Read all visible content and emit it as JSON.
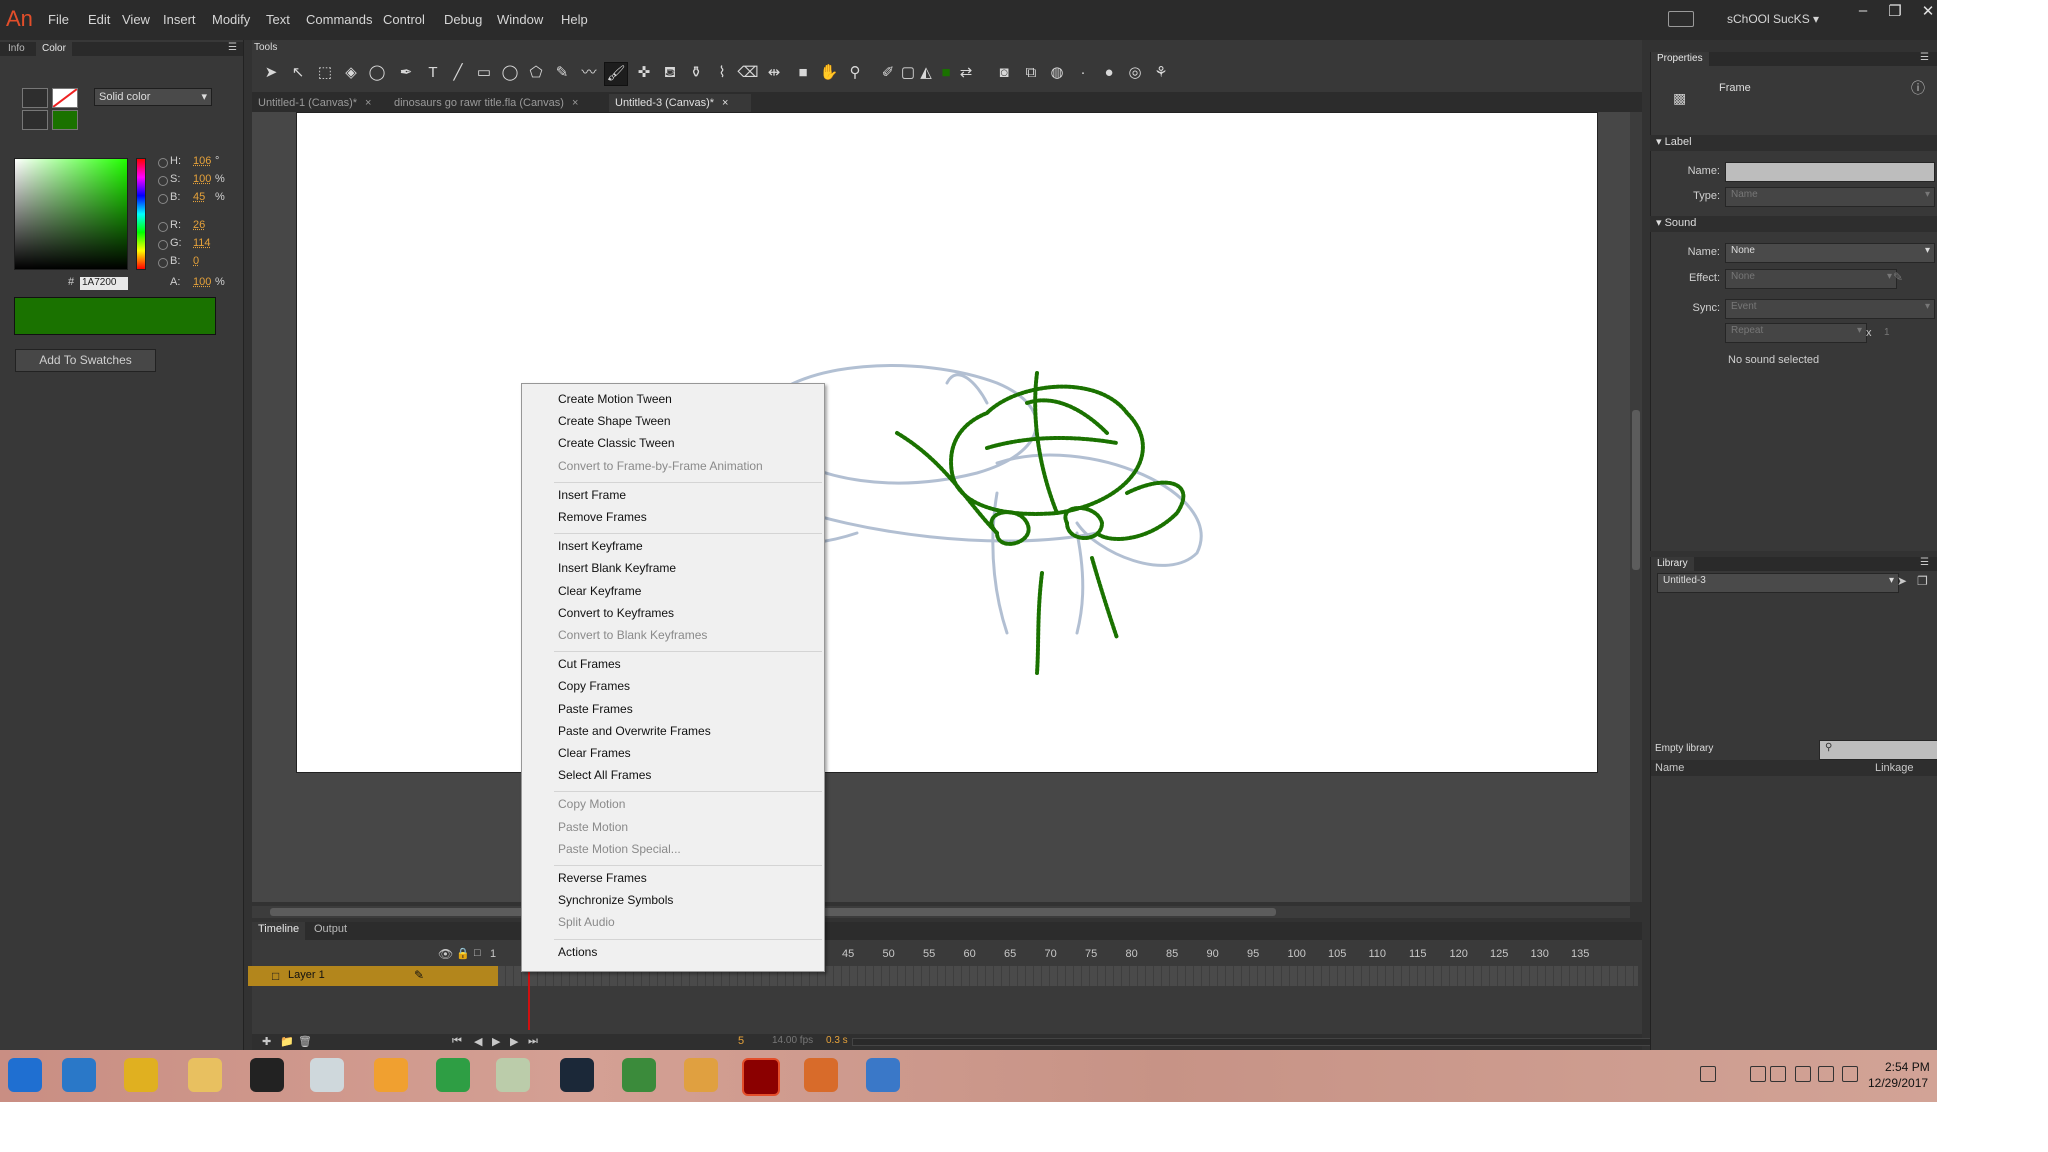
{
  "app": {
    "logo_text": "An",
    "menu": [
      "File",
      "Edit",
      "View",
      "Insert",
      "Modify",
      "Text",
      "Commands",
      "Control",
      "Debug",
      "Window",
      "Help"
    ],
    "user_name": "sChOOl SucKS",
    "user_caret": "▾"
  },
  "left_panel": {
    "tabs": [
      "Info",
      "Color"
    ],
    "fill_type": "Solid color",
    "hsb": [
      {
        "label": "H:",
        "value": "106",
        "unit": "°"
      },
      {
        "label": "S:",
        "value": "100",
        "unit": "%"
      },
      {
        "label": "B:",
        "value": "45",
        "unit": "%"
      }
    ],
    "rgb": [
      {
        "label": "R:",
        "value": "26"
      },
      {
        "label": "G:",
        "value": "114"
      },
      {
        "label": "B:",
        "value": "0"
      }
    ],
    "hex_label": "#",
    "hex_value": "1A7200",
    "alpha_label": "A:",
    "alpha_value": "100",
    "alpha_unit": "%",
    "add_to_swatches": "Add To Swatches",
    "current_color": "#1a7200"
  },
  "tools_panel": {
    "title": "Tools"
  },
  "document_tabs": [
    {
      "label": "Untitled-1 (Canvas)*",
      "close": "×"
    },
    {
      "label": "dinosaurs go rawr title.fla (Canvas)",
      "close": "×"
    },
    {
      "label": "Untitled-3 (Canvas)*",
      "close": "×"
    }
  ],
  "timeline": {
    "tabs": [
      "Timeline",
      "Output"
    ],
    "ruler_ticks": [
      "1",
      "45",
      "50",
      "55",
      "60",
      "65",
      "70",
      "75",
      "80",
      "85",
      "90",
      "95",
      "100",
      "105",
      "110",
      "115",
      "120",
      "125",
      "130",
      "135"
    ],
    "layer_name": "Layer 1",
    "current_frame": "5",
    "fps": "14.00 fps",
    "elapsed": "0.3 s"
  },
  "properties": {
    "title": "Properties",
    "frame_label": "Frame",
    "label_section": "Label",
    "name_label": "Name:",
    "type_label": "Type:",
    "type_value": "Name",
    "sound_section": "Sound",
    "sound_name_label": "Name:",
    "sound_name_value": "None",
    "effect_label": "Effect:",
    "effect_value": "None",
    "sync_label": "Sync:",
    "sync_value": "Event",
    "repeat_value": "Repeat",
    "repeat_x": "x",
    "repeat_count": "1",
    "no_sound": "No sound selected"
  },
  "library": {
    "title": "Library",
    "document": "Untitled-3",
    "empty": "Empty library",
    "col_name": "Name",
    "col_linkage": "Linkage"
  },
  "context_menu": {
    "groups": [
      [
        {
          "label": "Create Motion Tween",
          "enabled": true
        },
        {
          "label": "Create Shape Tween",
          "enabled": true
        },
        {
          "label": "Create Classic Tween",
          "enabled": true
        },
        {
          "label": "Convert to Frame-by-Frame Animation",
          "enabled": false
        }
      ],
      [
        {
          "label": "Insert Frame",
          "enabled": true
        },
        {
          "label": "Remove Frames",
          "enabled": true
        }
      ],
      [
        {
          "label": "Insert Keyframe",
          "enabled": true
        },
        {
          "label": "Insert Blank Keyframe",
          "enabled": true
        },
        {
          "label": "Clear Keyframe",
          "enabled": true
        },
        {
          "label": "Convert to Keyframes",
          "enabled": true
        },
        {
          "label": "Convert to Blank Keyframes",
          "enabled": false
        }
      ],
      [
        {
          "label": "Cut Frames",
          "enabled": true
        },
        {
          "label": "Copy Frames",
          "enabled": true
        },
        {
          "label": "Paste Frames",
          "enabled": true
        },
        {
          "label": "Paste and Overwrite Frames",
          "enabled": true
        },
        {
          "label": "Clear Frames",
          "enabled": true
        },
        {
          "label": "Select All Frames",
          "enabled": true
        }
      ],
      [
        {
          "label": "Copy Motion",
          "enabled": false
        },
        {
          "label": "Paste Motion",
          "enabled": false
        },
        {
          "label": "Paste Motion Special...",
          "enabled": false
        }
      ],
      [
        {
          "label": "Reverse Frames",
          "enabled": true
        },
        {
          "label": "Synchronize Symbols",
          "enabled": true
        },
        {
          "label": "Split Audio",
          "enabled": false
        }
      ],
      [
        {
          "label": "Actions",
          "enabled": true
        }
      ]
    ]
  },
  "taskbar": {
    "time": "2:54 PM",
    "date": "12/29/2017",
    "icons": [
      "start-icon",
      "internet-explorer-icon",
      "chrome-icon",
      "file-explorer-icon",
      "terminal-icon",
      "photos-icon",
      "paint-icon",
      "store-icon",
      "game-icon",
      "steam-icon",
      "map-app-icon",
      "pencil-app-icon",
      "animate-icon",
      "sublime-icon",
      "chrome-user-icon"
    ]
  },
  "colors": {
    "accent_layer": "#b3861c",
    "drawing_green": "#1a7200",
    "playhead": "#d01010"
  }
}
